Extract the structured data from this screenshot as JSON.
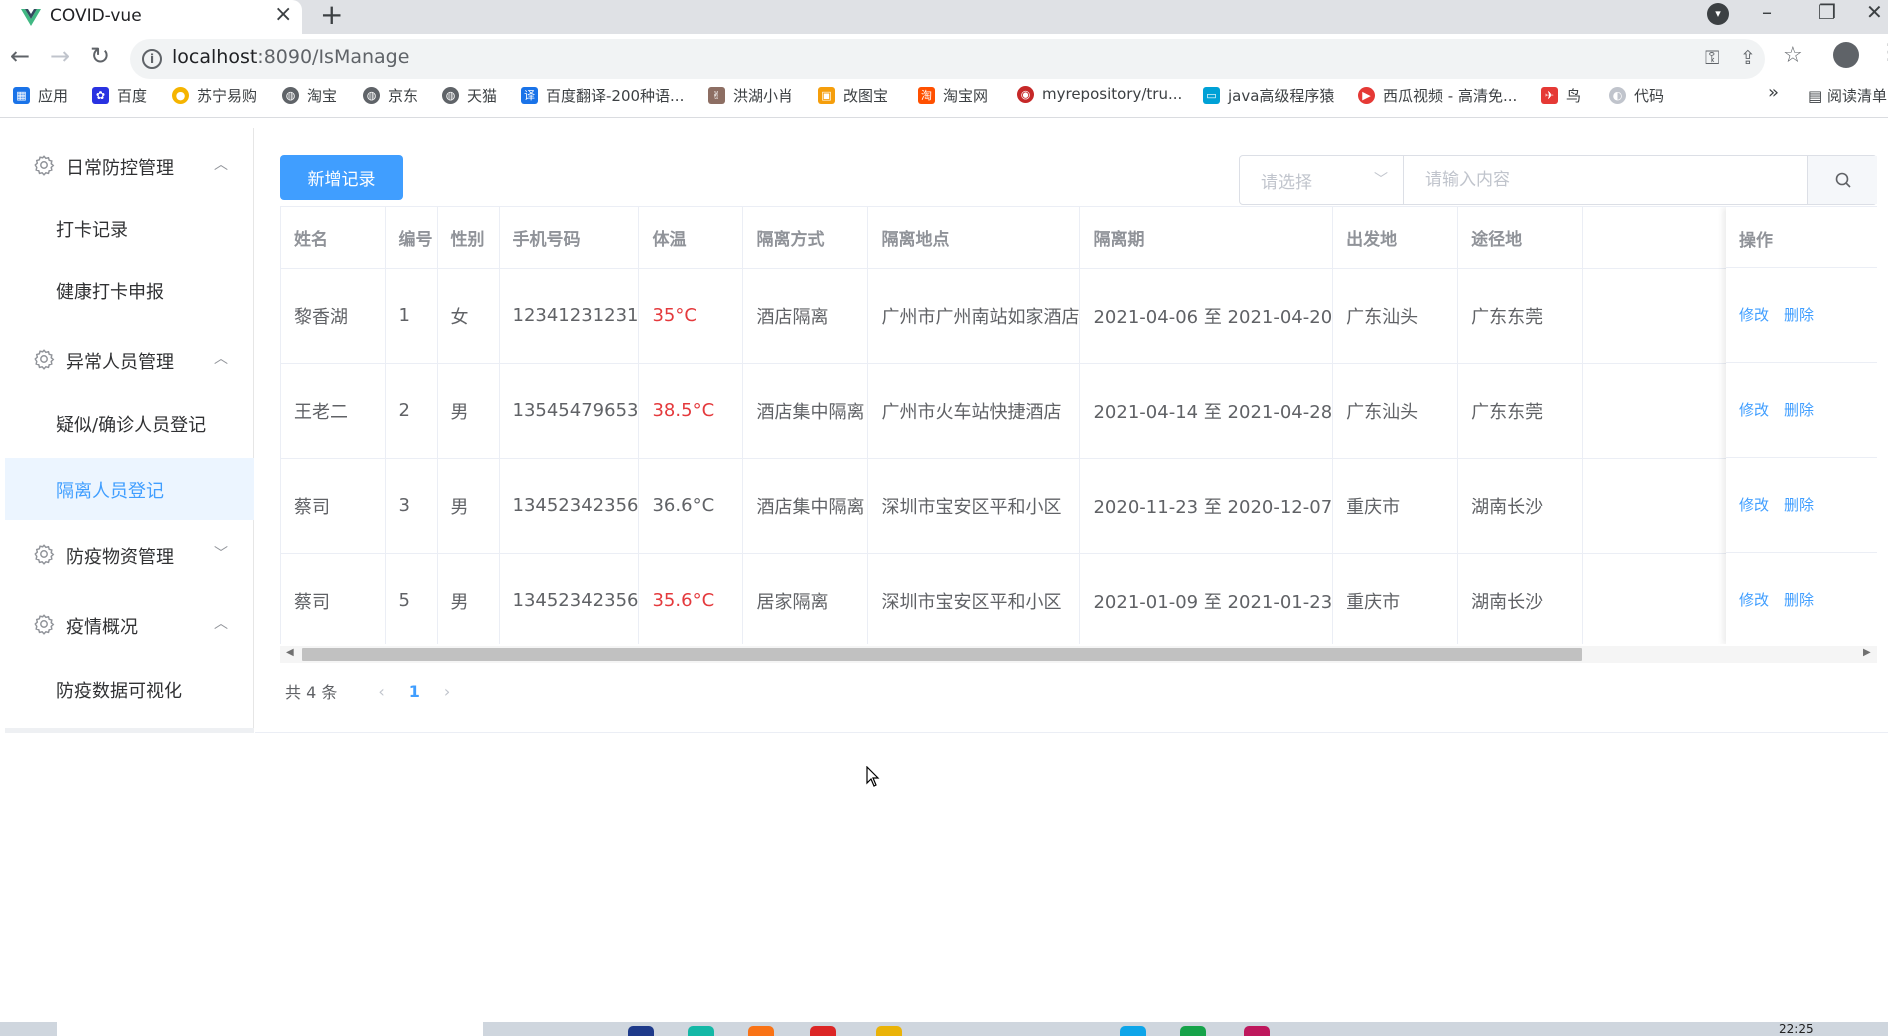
{
  "browser": {
    "tab_title": "COVID-vue",
    "url_host": "localhost",
    "url_path": ":8090/IsManage",
    "bookmarks": [
      {
        "label": "应用",
        "color": "#1a73e8"
      },
      {
        "label": "百度",
        "color": "#2932e1"
      },
      {
        "label": "苏宁易购",
        "color": "#f5b400"
      },
      {
        "label": "淘宝",
        "color": "#5f6368"
      },
      {
        "label": "京东",
        "color": "#5f6368"
      },
      {
        "label": "天猫",
        "color": "#5f6368"
      },
      {
        "label": "百度翻译-200种语...",
        "color": "#1a73e8"
      },
      {
        "label": "洪湖小肖",
        "color": "#8d6e63"
      },
      {
        "label": "改图宝",
        "color": "#f59e0b"
      },
      {
        "label": "淘宝网",
        "color": "#ff5000"
      },
      {
        "label": "myrepository/tru...",
        "color": "#c62828"
      },
      {
        "label": "java高级程序猿",
        "color": "#00a1d6"
      },
      {
        "label": "西瓜视频 - 高清免...",
        "color": "#e53935"
      },
      {
        "label": "鸟",
        "color": "#e53935"
      },
      {
        "label": "代码",
        "color": "#c0c4cc"
      }
    ],
    "reading_list": "阅读清单"
  },
  "sidebar": {
    "groups": [
      {
        "title": "日常防控管理",
        "chevron": "up"
      },
      {
        "title": "异常人员管理",
        "chevron": "up"
      },
      {
        "title": "防疫物资管理",
        "chevron": "down"
      },
      {
        "title": "疫情概况",
        "chevron": "up"
      }
    ],
    "items": [
      {
        "label": "打卡记录"
      },
      {
        "label": "健康打卡申报"
      },
      {
        "label": "疑似/确诊人员登记"
      },
      {
        "label": "隔离人员登记",
        "active": true
      },
      {
        "label": "防疫数据可视化"
      }
    ]
  },
  "toolbar": {
    "add_label": "新增记录",
    "select_placeholder": "请选择",
    "search_placeholder": "请输入内容"
  },
  "table": {
    "headers": [
      "姓名",
      "编号",
      "性别",
      "手机号码",
      "体温",
      "隔离方式",
      "隔离地点",
      "隔离期",
      "出发地",
      "途径地",
      "操作"
    ],
    "rows": [
      {
        "name": "黎香湖",
        "id": "1",
        "gender": "女",
        "phone": "12341231231",
        "temp": "35°C",
        "temp_alert": true,
        "method": "酒店隔离",
        "place": "广州市广州南站如家酒店",
        "period": "2021-04-06 至 2021-04-20",
        "from": "广东汕头",
        "via": "广东东莞"
      },
      {
        "name": "王老二",
        "id": "2",
        "gender": "男",
        "phone": "13545479653",
        "temp": "38.5°C",
        "temp_alert": true,
        "method": "酒店集中隔离",
        "place": "广州市火车站快捷酒店",
        "period": "2021-04-14 至 2021-04-28",
        "from": "广东汕头",
        "via": "广东东莞"
      },
      {
        "name": "蔡司",
        "id": "3",
        "gender": "男",
        "phone": "13452342356",
        "temp": "36.6°C",
        "temp_alert": false,
        "method": "酒店集中隔离",
        "place": "深圳市宝安区平和小区",
        "period": "2020-11-23 至 2020-12-07",
        "from": "重庆市",
        "via": "湖南长沙"
      },
      {
        "name": "蔡司",
        "id": "5",
        "gender": "男",
        "phone": "13452342356",
        "temp": "35.6°C",
        "temp_alert": true,
        "method": "居家隔离",
        "place": "深圳市宝安区平和小区",
        "period": "2021-01-09 至 2021-01-23",
        "from": "重庆市",
        "via": "湖南长沙"
      }
    ],
    "edit_label": "修改",
    "delete_label": "删除"
  },
  "pagination": {
    "total_label": "共 4 条",
    "current_page": "1"
  },
  "taskbar": {
    "clock": "22:25"
  },
  "colors": {
    "primary": "#409eff",
    "alert": "#e4393c",
    "active_bg": "#ecf5ff"
  }
}
